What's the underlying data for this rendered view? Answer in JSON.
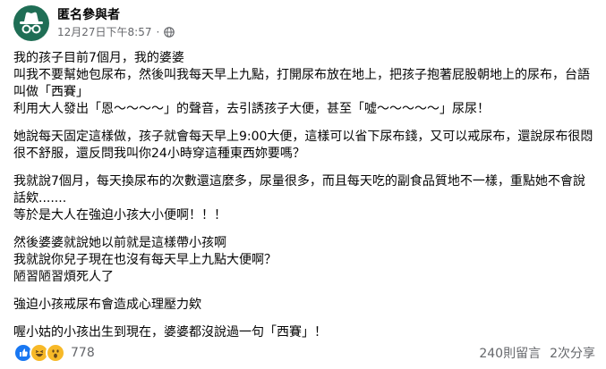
{
  "post": {
    "author": "匿名參與者",
    "timestamp": "12月27日下午8:57",
    "separator": "·",
    "privacy_icon": "globe-icon",
    "avatar_icon": "incognito-icon",
    "paragraphs": [
      [
        "我的孩子目前7個月，我的婆婆",
        "叫我不要幫她包尿布，然後叫我每天早上九點，打開尿布放在地上，把孩子抱著屁股朝地上的尿布，台語叫做「西賽」",
        "利用大人發出「恩～～～～」的聲音，去引誘孩子大便，甚至「噓～～～～～」尿尿！"
      ],
      [
        "她說每天固定這樣做，孩子就會每天早上9:00大便，這樣可以省下尿布錢，又可以戒尿布，還說尿布很悶很不舒服，還反問我叫你24小時穿這種東西妳要嗎？"
      ],
      [
        "我就說7個月，每天換尿布的次數還這麼多，尿量很多，而且每天吃的副食品質地不一樣，重點她不會說話欸.......",
        "等於是大人在強迫小孩大小便啊！！！"
      ],
      [
        "然後婆婆就說她以前就是這樣帶小孩啊",
        "我就說你兒子現在也沒有每天早上九點大便啊？",
        "陋習陋習煩死人了"
      ],
      [
        "強迫小孩戒尿布會造成心理壓力欸"
      ],
      [
        "喔小姑的小孩出生到現在，婆婆都沒說過一句「西賽」！"
      ]
    ],
    "reactions": {
      "icons": [
        "like-icon",
        "haha-icon",
        "wow-icon"
      ],
      "count": "778"
    },
    "comments": "240則留言",
    "shares": "2次分享"
  },
  "colors": {
    "text": "#050505",
    "muted": "#65676b",
    "avatar_bg": "#1f6e55",
    "like": "#1877f2",
    "emoji": "#f7b928"
  }
}
